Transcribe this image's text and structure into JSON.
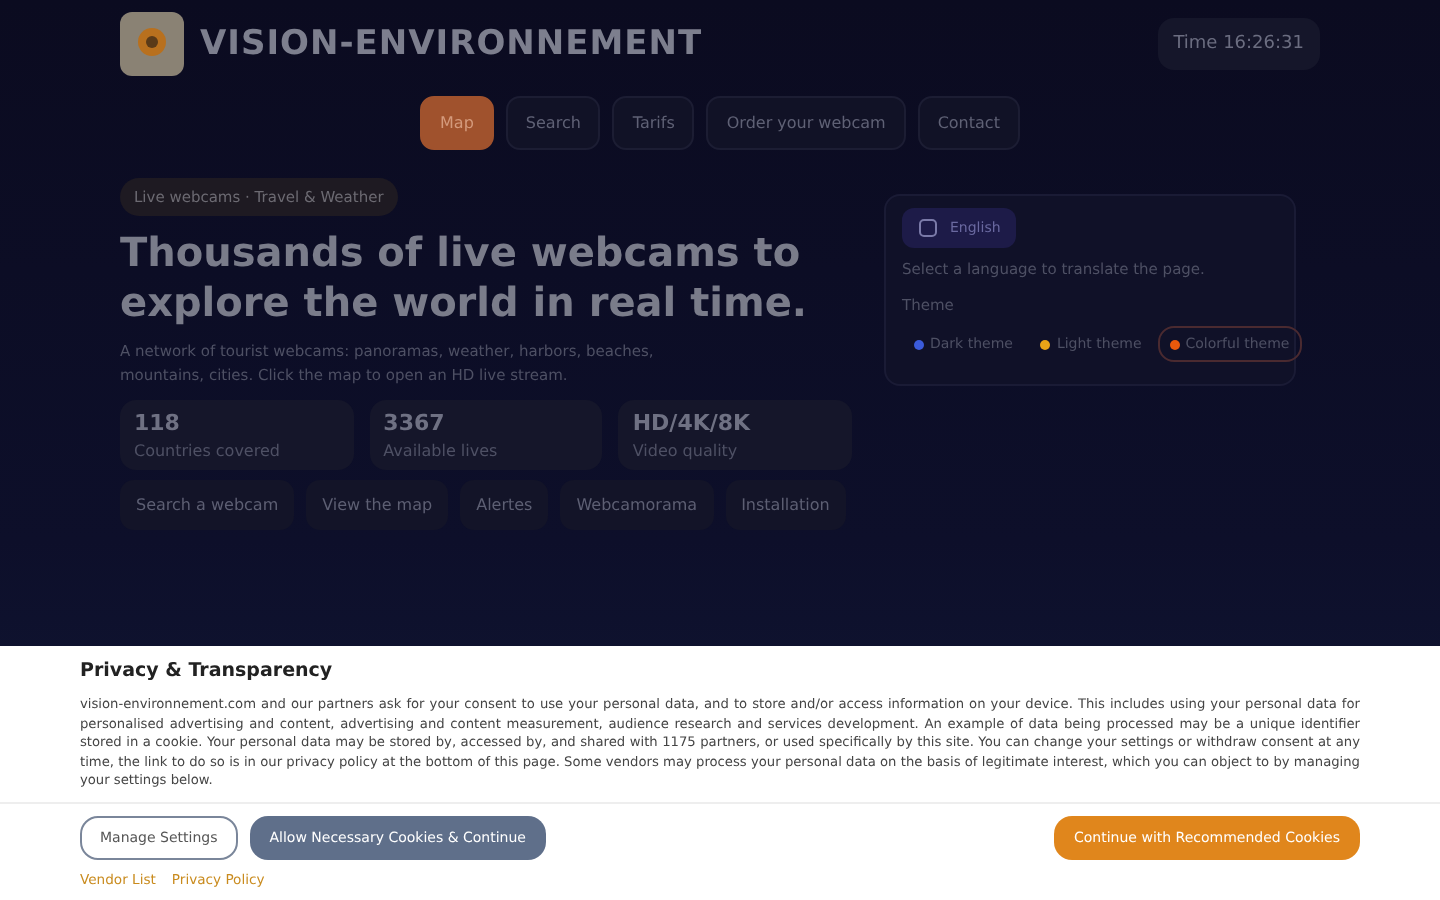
{
  "header": {
    "brand": "VISION-ENVIRONNEMENT",
    "time": "Time 16:26:31"
  },
  "nav": [
    {
      "label": "Map",
      "selected": true
    },
    {
      "label": "Search",
      "selected": false
    },
    {
      "label": "Tarifs",
      "selected": false
    },
    {
      "label": "Order your webcam",
      "selected": false
    },
    {
      "label": "Contact",
      "selected": false
    }
  ],
  "hero": {
    "badge": "Live webcams · Travel & Weather",
    "headline": "Thousands of live webcams to explore the world in real time.",
    "description": "A network of tourist webcams: panoramas, weather, harbors, beaches, mountains, cities. Click the map to open an HD live stream.",
    "stats": [
      {
        "value": "118",
        "label": "Countries covered"
      },
      {
        "value": "3367",
        "label": "Available lives"
      },
      {
        "value": "HD/4K/8K",
        "label": "Video quality"
      }
    ],
    "actions": [
      "Search a webcam",
      "View the map",
      "Alertes",
      "Webcamorama",
      "Installation"
    ]
  },
  "language_panel": {
    "language": "English",
    "hint": "Select a language to translate the page.",
    "theme_label": "Theme",
    "themes": [
      {
        "label": "Dark theme",
        "color": "#3b5bdb",
        "selected": false
      },
      {
        "label": "Light theme",
        "color": "#e8a317",
        "selected": false
      },
      {
        "label": "Colorful theme",
        "color": "#e8590c",
        "selected": true
      }
    ]
  },
  "consent": {
    "title": "Privacy & Transparency",
    "text": "vision-environnement.com and our partners ask for your consent to use your personal data, and to store and/or access information on your device. This includes using your personal data for personalised advertising and content, advertising and content measurement, audience research and services development. An example of data being processed may be a unique identifier stored in a cookie. Your personal data may be stored by, accessed by, and shared with 1175 partners, or used specifically by this site. You can change your settings or withdraw consent at any time, the link to do so is in our privacy policy at the bottom of this page. Some vendors may process your personal data on the basis of legitimate interest, which you can object to by managing your settings below.",
    "buttons": [
      {
        "label": "Manage Settings",
        "kind": "outline"
      },
      {
        "label": "Allow Necessary Cookies & Continue",
        "kind": "slate"
      },
      {
        "label": "Continue with Recommended Cookies",
        "kind": "primary"
      }
    ],
    "links": [
      "Vendor List",
      "Privacy Policy"
    ]
  }
}
